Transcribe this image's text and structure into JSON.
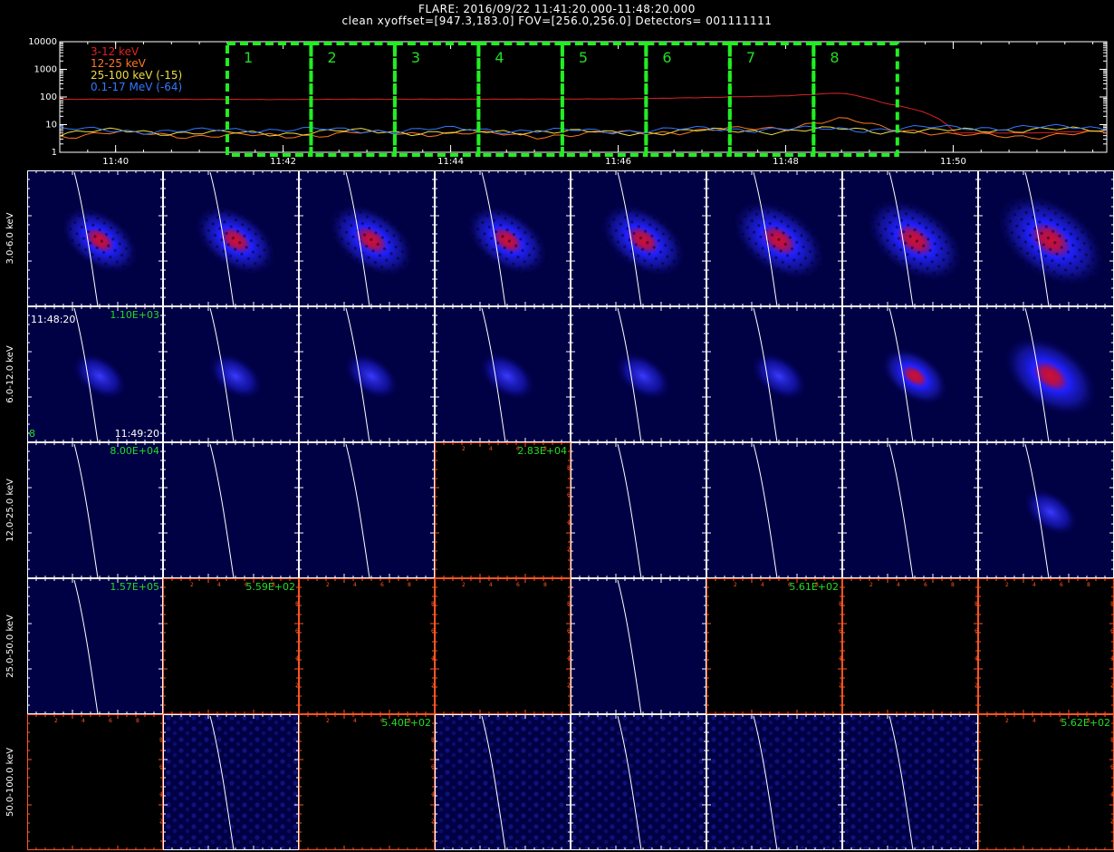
{
  "header": {
    "title_line1": "FLARE: 2016/09/22 11:41:20.000-11:48:20.000",
    "title_line2": "clean    xyoffset=[947.3,183.0]    FOV=[256.0,256.0]    Detectors= 001111111"
  },
  "chart_data": [
    {
      "type": "line",
      "yscale": "log",
      "ylim": [
        1,
        10000
      ],
      "xlim": [
        "11:39:20",
        "11:51:50"
      ],
      "y_tick_labels": [
        "1",
        "10",
        "100",
        "1000",
        "10000"
      ],
      "x_tick_labels": [
        "11:40",
        "11:42",
        "11:44",
        "11:46",
        "11:48",
        "11:50"
      ],
      "legend": {
        "position": "top-left",
        "entries": [
          {
            "label": "3-12 keV",
            "color": "#dd2222"
          },
          {
            "label": "12-25 keV",
            "color": "#ff7722"
          },
          {
            "label": "25-100 keV (-15)",
            "color": "#eedd44"
          },
          {
            "label": "0.1-17 MeV (-64)",
            "color": "#3377ff"
          }
        ]
      },
      "x_times": [
        "11:39:20",
        "11:40:00",
        "11:41:00",
        "11:42:00",
        "11:43:00",
        "11:44:00",
        "11:45:00",
        "11:46:00",
        "11:47:00",
        "11:48:00",
        "11:48:40",
        "11:49:10",
        "11:50:00",
        "11:51:00",
        "11:51:50"
      ],
      "series": [
        {
          "name": "3-12 keV",
          "color": "#dd2222",
          "values": [
            82,
            84,
            82,
            81,
            83,
            83,
            84,
            85,
            95,
            110,
            140,
            60,
            5,
            5,
            6
          ]
        },
        {
          "name": "12-25 keV",
          "color": "#ff7722",
          "values": [
            4,
            5,
            4,
            4,
            5,
            5,
            4,
            5,
            6,
            8,
            15,
            8,
            4,
            4,
            5
          ]
        },
        {
          "name": "25-100 keV (-15)",
          "color": "#eedd44",
          "values": [
            5,
            6,
            5,
            5,
            6,
            5,
            6,
            5,
            6,
            6,
            7,
            6,
            6,
            7,
            6
          ]
        },
        {
          "name": "0.1-17 MeV (-64)",
          "color": "#3377ff",
          "values": [
            7,
            6,
            6,
            7,
            6,
            7,
            6,
            6,
            7,
            7,
            7,
            7,
            8,
            8,
            8
          ]
        }
      ],
      "intervals": [
        {
          "label": "1",
          "start": "11:41:20",
          "end": "11:42:20"
        },
        {
          "label": "2",
          "start": "11:42:20",
          "end": "11:43:20"
        },
        {
          "label": "3",
          "start": "11:43:20",
          "end": "11:44:20"
        },
        {
          "label": "4",
          "start": "11:44:20",
          "end": "11:45:20"
        },
        {
          "label": "5",
          "start": "11:45:20",
          "end": "11:46:20"
        },
        {
          "label": "6",
          "start": "11:46:20",
          "end": "11:47:20"
        },
        {
          "label": "7",
          "start": "11:47:20",
          "end": "11:48:20"
        },
        {
          "label": "8",
          "start": "11:48:20",
          "end": "11:49:20"
        }
      ],
      "interval_color": "#22ee22"
    },
    {
      "type": "heatmap",
      "energy_bands": [
        "3.0-6.0 keV",
        "6.0-12.0 keV",
        "12.0-25.0 keV",
        "25.0-50.0 keV",
        "50.0-100.0 keV"
      ],
      "columns": 8,
      "first_panel_label": {
        "start_time": "11:48:20",
        "end_time": "11:49:20",
        "interval": "8"
      },
      "peak_labels": [
        {
          "row": 1,
          "col": 0,
          "text": "1.10E+03"
        },
        {
          "row": 2,
          "col": 0,
          "text": "8.00E+04"
        },
        {
          "row": 2,
          "col": 3,
          "text": "2.83E+04"
        },
        {
          "row": 3,
          "col": 0,
          "text": "1.57E+05"
        },
        {
          "row": 3,
          "col": 1,
          "text": "5.59E+02"
        },
        {
          "row": 3,
          "col": 5,
          "text": "5.61E+02"
        },
        {
          "row": 4,
          "col": 2,
          "text": "5.40E+02"
        },
        {
          "row": 4,
          "col": 7,
          "text": "5.62E+02"
        }
      ],
      "panels": [
        [
          "source",
          "source",
          "source",
          "source",
          "source",
          "source",
          "source",
          "source"
        ],
        [
          "source",
          "source",
          "source",
          "source",
          "source",
          "source",
          "source",
          "source"
        ],
        [
          "limb",
          "limb",
          "limb",
          "empty",
          "limb",
          "limb",
          "limb",
          "source"
        ],
        [
          "limb",
          "empty",
          "empty",
          "empty",
          "limb",
          "empty",
          "empty",
          "empty"
        ],
        [
          "empty",
          "noise",
          "empty",
          "noise",
          "noise",
          "noise",
          "noise",
          "empty"
        ]
      ],
      "source_strength": [
        [
          0.6,
          0.65,
          0.7,
          0.65,
          0.7,
          0.8,
          0.85,
          1.0
        ],
        [
          0.3,
          0.3,
          0.3,
          0.32,
          0.32,
          0.32,
          0.45,
          0.8
        ],
        [
          0,
          0,
          0,
          0,
          0,
          0,
          0,
          0.3
        ],
        [
          0,
          0,
          0,
          0,
          0,
          0,
          0,
          0
        ],
        [
          0,
          0,
          0,
          0,
          0,
          0,
          0,
          0
        ]
      ],
      "small_axis_ticks": [
        "2",
        "4",
        "6",
        "8"
      ]
    }
  ]
}
